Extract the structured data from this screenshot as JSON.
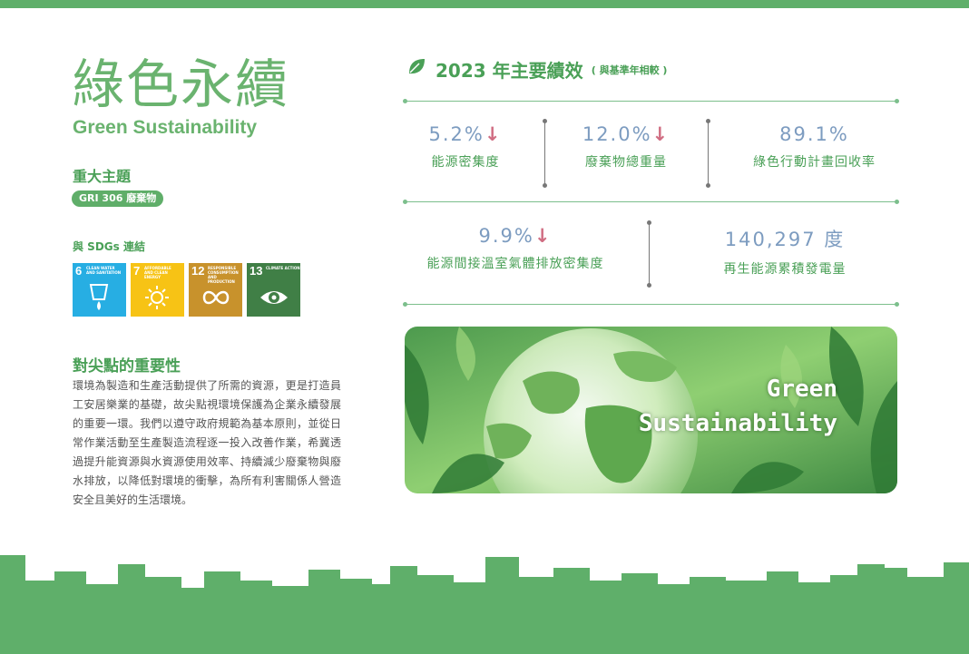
{
  "colors": {
    "brand_green": "#5faf6a",
    "value_blue": "#7d9cc0",
    "arrow_red": "#d06d82"
  },
  "header": {
    "title_zh": "綠色永續",
    "title_en": "Green Sustainability"
  },
  "topic": {
    "heading": "重大主題",
    "badge": "GRI 306 廢棄物"
  },
  "sdgs": {
    "heading": "與 SDGs 連結",
    "items": [
      {
        "num": "6",
        "text": "CLEAN WATER AND SANITATION",
        "color": "#27aee3",
        "icon": "water-icon"
      },
      {
        "num": "7",
        "text": "AFFORDABLE AND CLEAN ENERGY",
        "color": "#f7c315",
        "icon": "sun-icon"
      },
      {
        "num": "12",
        "text": "RESPONSIBLE CONSUMPTION AND PRODUCTION",
        "color": "#c8922c",
        "icon": "infinity-icon"
      },
      {
        "num": "13",
        "text": "CLIMATE ACTION",
        "color": "#407f46",
        "icon": "eye-globe-icon"
      }
    ]
  },
  "importance": {
    "heading": "對尖點的重要性",
    "body": "環境為製造和生產活動提供了所需的資源，更是打造員工安居樂業的基礎，故尖點視環境保護為企業永續發展的重要一環。我們以遵守政府規範為基本原則，並從日常作業活動至生產製造流程逐一投入改善作業，希冀透過提升能資源與水資源使用效率、持續減少廢棄物與廢水排放，以降低對環境的衝擊，為所有利害關係人營造安全且美好的生活環境。"
  },
  "performance": {
    "title": "2023 年主要績效",
    "subtitle": "( 與基準年相較 )",
    "metrics": [
      {
        "value": "5.2%",
        "arrow": "↓",
        "label": "能源密集度"
      },
      {
        "value": "12.0%",
        "arrow": "↓",
        "label": "廢棄物總重量"
      },
      {
        "value": "89.1%",
        "arrow": "",
        "label": "綠色行動計畫回收率"
      },
      {
        "value": "9.9%",
        "arrow": "↓",
        "label": "能源間接溫室氣體排放密集度"
      },
      {
        "value": "140,297 度",
        "arrow": "",
        "label": "再生能源累積發電量"
      }
    ]
  },
  "banner": {
    "line1": "Green",
    "line2": "Sustainability",
    "image": "green-earth-leaves-image"
  }
}
